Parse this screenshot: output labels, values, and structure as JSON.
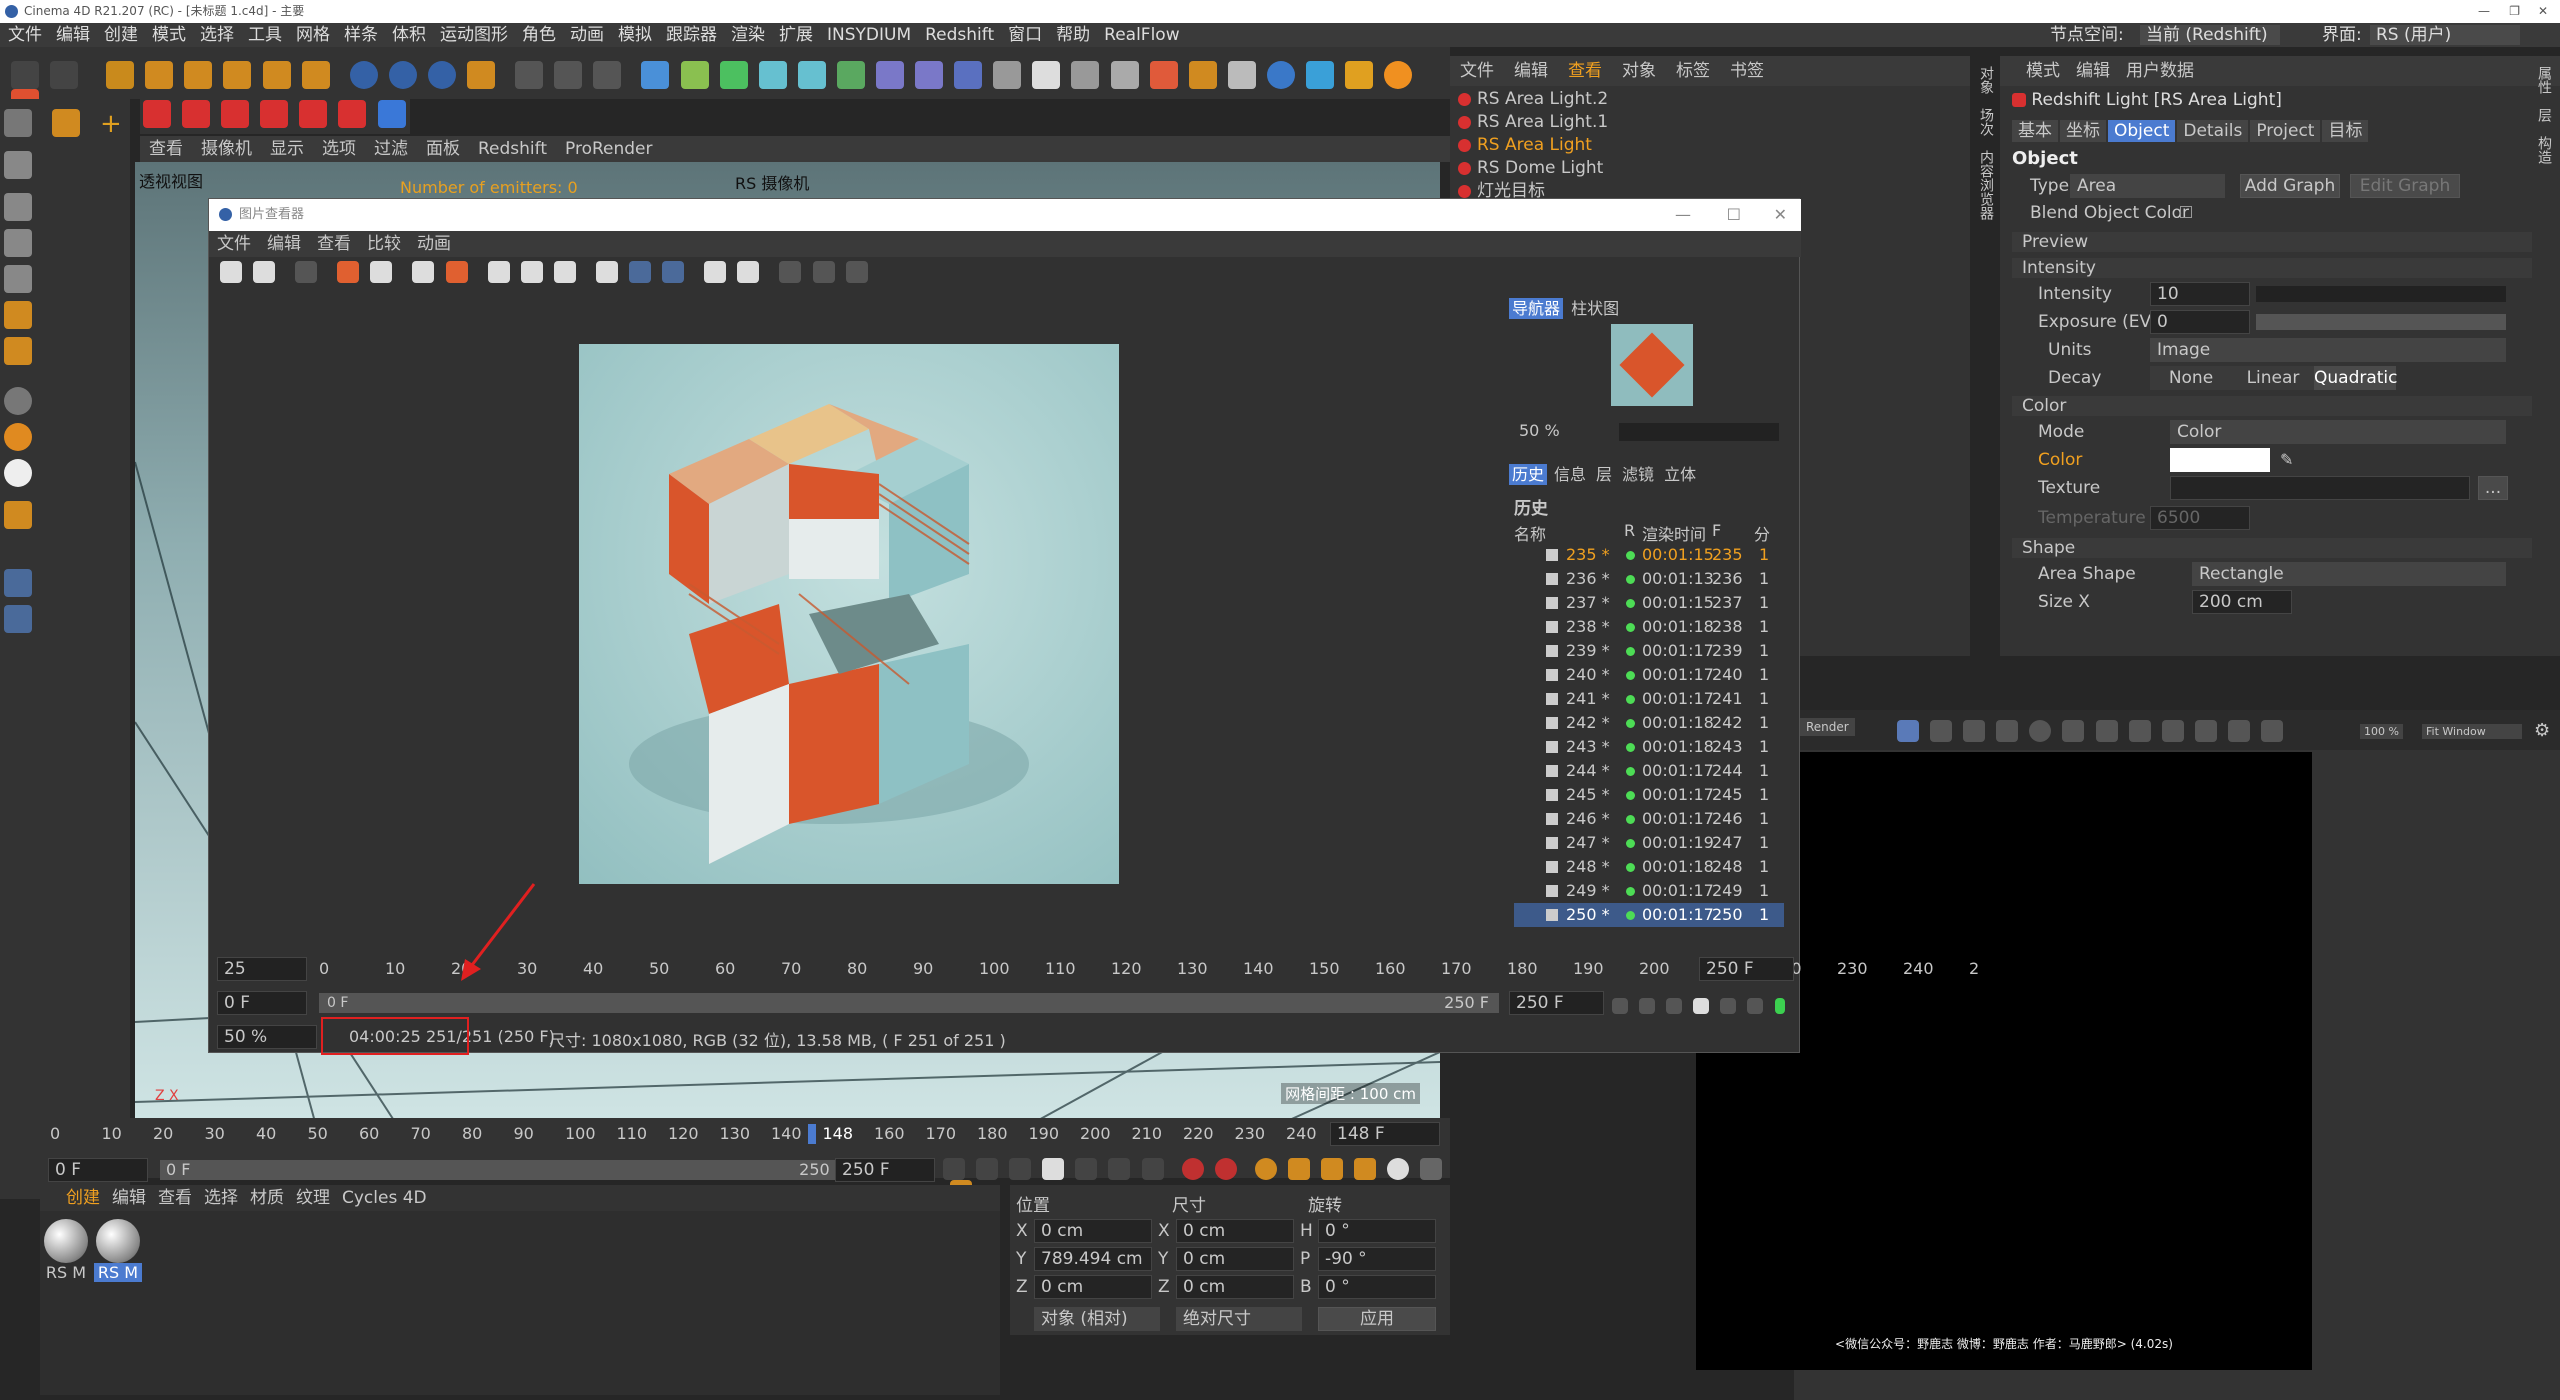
{
  "app": {
    "title": "Cinema 4D R21.207 (RC) - [未标题 1.c4d] - 主要"
  },
  "menu": [
    "文件",
    "编辑",
    "创建",
    "模式",
    "选择",
    "工具",
    "网格",
    "样条",
    "体积",
    "运动图形",
    "角色",
    "动画",
    "模拟",
    "跟踪器",
    "渲染",
    "扩展",
    "INSYDIUM",
    "Redshift",
    "窗口",
    "帮助",
    "RealFlow"
  ],
  "node_space": {
    "label": "节点空间:",
    "value": "当前 (Redshift)"
  },
  "layout": {
    "label": "界面:",
    "value": "RS (用户)"
  },
  "viewport": {
    "menu": [
      "查看",
      "摄像机",
      "显示",
      "选项",
      "过滤",
      "面板",
      "Redshift",
      "ProRender"
    ],
    "name": "透视视图",
    "emitters": "Number of emitters: 0",
    "camera": "RS 摄像机",
    "grid_info": "网格间距 : 100 cm"
  },
  "objmgr": {
    "menu": [
      "文件",
      "编辑",
      "查看",
      "对象",
      "标签",
      "书签"
    ],
    "objects": [
      "RS Area Light.2",
      "RS Area Light.1",
      "RS Area Light",
      "RS Dome Light",
      "灯光目标"
    ],
    "side_tabs": [
      "对象",
      "场次",
      "内容浏览器"
    ]
  },
  "attr": {
    "menu": [
      "模式",
      "编辑",
      "用户数据"
    ],
    "title": "Redshift Light [RS Area Light]",
    "tabs": [
      "基本",
      "坐标",
      "Object",
      "Details",
      "Project",
      "目标"
    ],
    "section": "Object",
    "type_label": "Type",
    "type_value": "Area",
    "add_graph": "Add Graph",
    "edit_graph": "Edit Graph",
    "blend_color": "Blend Object Color",
    "preview": "Preview",
    "intensity_group": "Intensity",
    "intensity_label": "Intensity",
    "intensity_value": "10",
    "exposure_label": "Exposure (EV)",
    "exposure_value": "0",
    "units_label": "Units",
    "units_value": "Image",
    "decay_label": "Decay",
    "decay_options": [
      "None",
      "Linear",
      "Quadratic"
    ],
    "color_group": "Color",
    "mode_label": "Mode",
    "mode_value": "Color",
    "color_label": "Color",
    "texture_label": "Texture",
    "temperature_label": "Temperature (K)",
    "temperature_value": "6500",
    "shape_group": "Shape",
    "area_shape_label": "Area Shape",
    "area_shape_value": "Rectangle",
    "sizex_label": "Size X",
    "sizex_value": "200 cm",
    "side_tabs": [
      "属性",
      "层",
      "构造"
    ]
  },
  "picviewer": {
    "title": "图片查看器",
    "menu": [
      "文件",
      "编辑",
      "查看",
      "比较",
      "动画"
    ],
    "nav_tabs": [
      "导航器",
      "柱状图"
    ],
    "zoom": "50 %",
    "hist_tabs": [
      "历史",
      "信息",
      "层",
      "滤镜",
      "立体"
    ],
    "hist_title": "历史",
    "columns": [
      "名称",
      "R",
      "渲染时间",
      "F",
      "分"
    ],
    "rows": [
      {
        "n": "235 *",
        "t": "00:01:15",
        "f": "235",
        "s": "1"
      },
      {
        "n": "236 *",
        "t": "00:01:13",
        "f": "236",
        "s": "1"
      },
      {
        "n": "237 *",
        "t": "00:01:15",
        "f": "237",
        "s": "1"
      },
      {
        "n": "238 *",
        "t": "00:01:18",
        "f": "238",
        "s": "1"
      },
      {
        "n": "239 *",
        "t": "00:01:17",
        "f": "239",
        "s": "1"
      },
      {
        "n": "240 *",
        "t": "00:01:17",
        "f": "240",
        "s": "1"
      },
      {
        "n": "241 *",
        "t": "00:01:17",
        "f": "241",
        "s": "1"
      },
      {
        "n": "242 *",
        "t": "00:01:18",
        "f": "242",
        "s": "1"
      },
      {
        "n": "243 *",
        "t": "00:01:18",
        "f": "243",
        "s": "1"
      },
      {
        "n": "244 *",
        "t": "00:01:17",
        "f": "244",
        "s": "1"
      },
      {
        "n": "245 *",
        "t": "00:01:17",
        "f": "245",
        "s": "1"
      },
      {
        "n": "246 *",
        "t": "00:01:17",
        "f": "246",
        "s": "1"
      },
      {
        "n": "247 *",
        "t": "00:01:19",
        "f": "247",
        "s": "1"
      },
      {
        "n": "248 *",
        "t": "00:01:18",
        "f": "248",
        "s": "1"
      },
      {
        "n": "249 *",
        "t": "00:01:17",
        "f": "249",
        "s": "1"
      },
      {
        "n": "250 *",
        "t": "00:01:17",
        "f": "250",
        "s": "1"
      }
    ],
    "timeline_start": "25",
    "ticks": [
      "0",
      "10",
      "20",
      "30",
      "40",
      "50",
      "60",
      "70",
      "80",
      "90",
      "100",
      "110",
      "120",
      "130",
      "140",
      "150",
      "160",
      "170",
      "180",
      "190",
      "200",
      "210",
      "220",
      "230",
      "240",
      "2"
    ],
    "end_frame": "250 F",
    "cur_frame": "0 F",
    "range_start": "0 F",
    "range_end": "250 F",
    "range_end2": "250 F",
    "status_zoom": "50 %",
    "status_time": "04:00:25 251/251 (250 F)",
    "status_info": "尺寸: 1080x1080, RGB (32 位), 13.58 MB,  ( F 251 of 251 )"
  },
  "timeline": {
    "ticks": [
      "0",
      "10",
      "20",
      "30",
      "40",
      "50",
      "60",
      "70",
      "80",
      "90",
      "100",
      "110",
      "120",
      "130",
      "140",
      "148",
      "160",
      "170",
      "180",
      "190",
      "200",
      "210",
      "220",
      "230",
      "240",
      "25"
    ],
    "current": "148 F",
    "start": "0 F",
    "range_start": "0 F",
    "range_end": "250 F",
    "end": "250 F"
  },
  "matmgr": {
    "menu": [
      "创建",
      "编辑",
      "查看",
      "选择",
      "材质",
      "纹理",
      "Cycles 4D"
    ],
    "materials": [
      "RS M",
      "RS M"
    ]
  },
  "coord": {
    "headers": [
      "位置",
      "尺寸",
      "旋转"
    ],
    "x": "0 cm",
    "y": "789.494 cm",
    "z": "0 cm",
    "sx": "0 cm",
    "sy": "0 cm",
    "sz": "0 cm",
    "h": "0 °",
    "p": "-90 °",
    "b": "0 °",
    "mode1": "对象 (相对)",
    "mode2": "绝对尺寸",
    "apply": "应用",
    "axes": [
      "X",
      "Y",
      "Z",
      "X",
      "Y",
      "Z",
      "H",
      "P",
      "B"
    ]
  },
  "renderview": {
    "zoom": "100 %",
    "fit": "Fit Window",
    "render": "Render",
    "credit": "<微信公众号：野鹿志  微博：野鹿志  作者：马鹿野郎> (4.02s)"
  },
  "colors": {
    "accent": "#4b7bd0",
    "orange": "#f0a020",
    "tile_orange": "#d9552b",
    "tile_teal": "#8ec1c4"
  }
}
